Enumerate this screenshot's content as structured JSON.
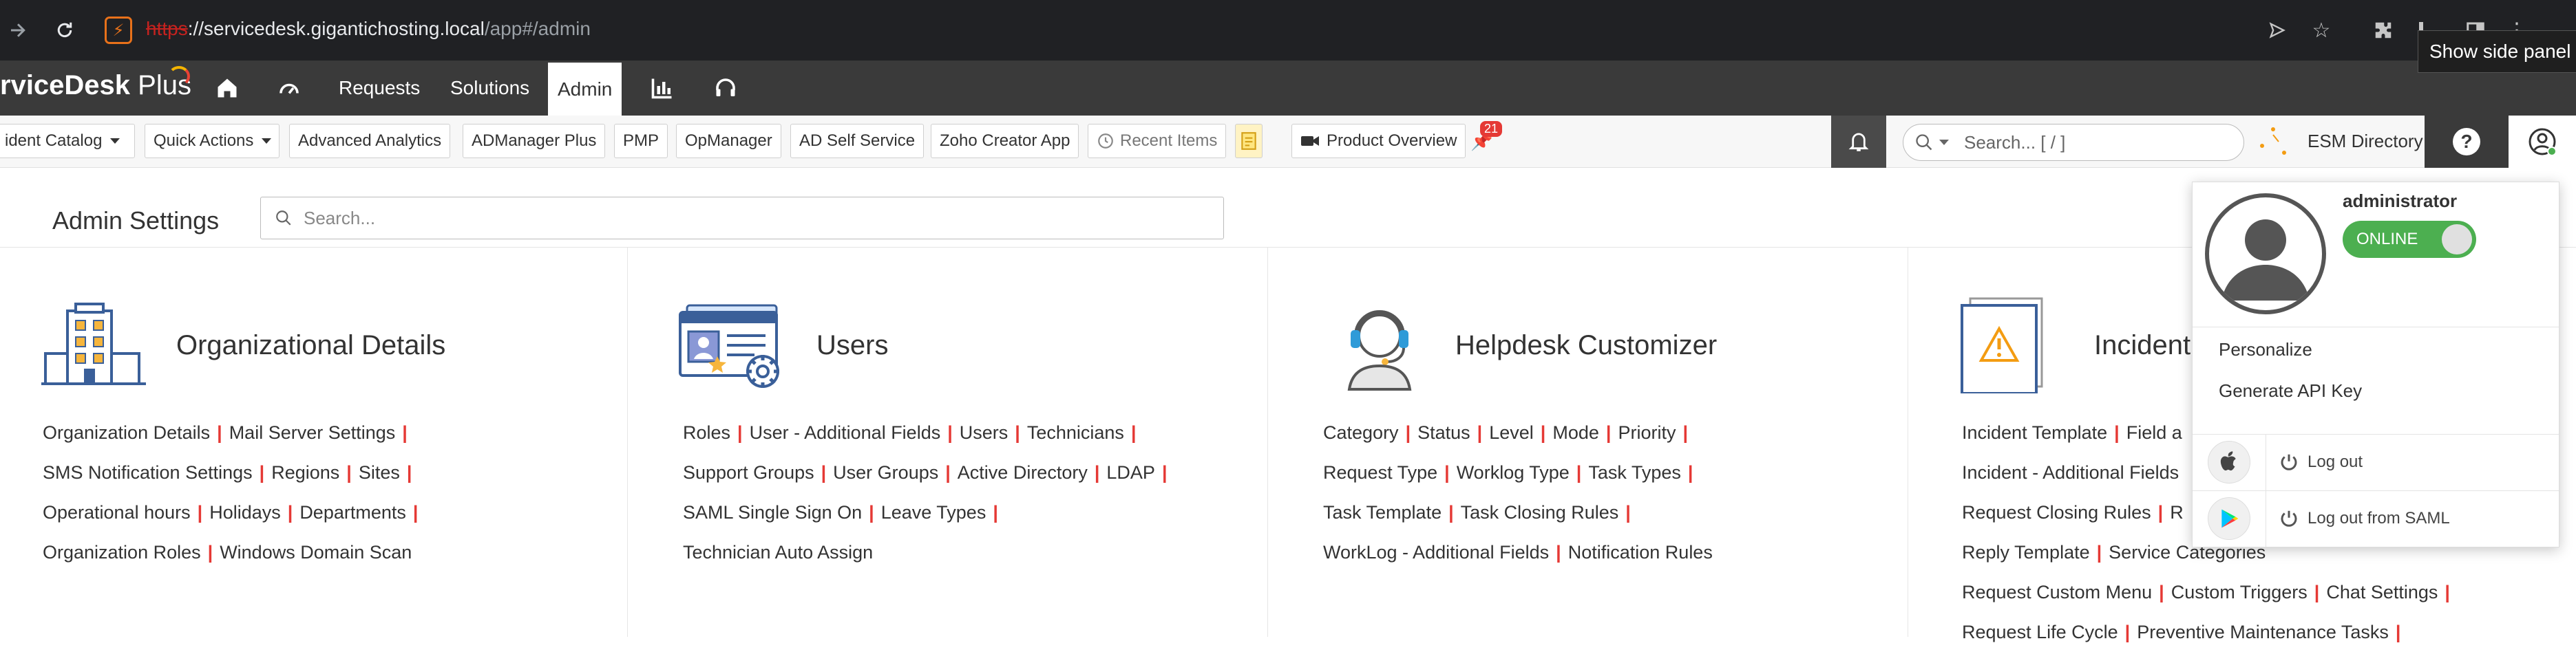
{
  "browser": {
    "url_protocol": "https",
    "url_host": "://servicedesk.gigantichosting.local",
    "url_path": "/app#/admin",
    "tooltip": "Show side panel"
  },
  "app": {
    "logo_bold": "rviceDesk",
    "logo_light": " Plus",
    "nav_tabs": [
      "Requests",
      "Solutions",
      "Admin"
    ],
    "active_tab": "Admin"
  },
  "toolbar": {
    "items": [
      "ident Catalog",
      "Quick Actions",
      "Advanced Analytics",
      "ADManager Plus",
      "PMP",
      "OpManager",
      "AD Self Service",
      "Zoho Creator App",
      "Recent Items",
      "Product Overview"
    ],
    "notification_count": "21",
    "search_placeholder": "Search... [ / ]",
    "esm_label": "ESM Directory"
  },
  "admin": {
    "title": "Admin Settings",
    "search_placeholder": "Search..."
  },
  "cards": [
    {
      "title": "Organizational Details",
      "rows": [
        [
          "Organization Details",
          "Mail Server Settings"
        ],
        [
          "SMS Notification Settings",
          "Regions",
          "Sites"
        ],
        [
          "Operational hours",
          "Holidays",
          "Departments"
        ],
        [
          "Organization Roles",
          "Windows Domain Scan"
        ]
      ]
    },
    {
      "title": "Users",
      "rows": [
        [
          "Roles",
          "User - Additional Fields",
          "Users",
          "Technicians"
        ],
        [
          "Support Groups",
          "User Groups",
          "Active Directory",
          "LDAP"
        ],
        [
          "SAML Single Sign On",
          "Leave Types"
        ],
        [
          "Technician Auto Assign"
        ]
      ]
    },
    {
      "title": "Helpdesk Customizer",
      "rows": [
        [
          "Category",
          "Status",
          "Level",
          "Mode",
          "Priority"
        ],
        [
          "Request Type",
          "Worklog Type",
          "Task Types"
        ],
        [
          "Task Template",
          "Task Closing Rules"
        ],
        [
          "WorkLog - Additional Fields",
          "Notification Rules"
        ]
      ]
    },
    {
      "title": "Incident",
      "rows": [
        [
          "Incident Template",
          "Field a"
        ],
        [
          "Incident - Additional Fields"
        ],
        [
          "Request Closing Rules",
          "R"
        ],
        [
          "Reply Template",
          "Service Categories"
        ],
        [
          "Request Custom Menu",
          "Custom Triggers",
          "Chat Settings"
        ],
        [
          "Request Life Cycle",
          "Preventive Maintenance Tasks"
        ]
      ]
    }
  ],
  "profile_menu": {
    "username": "administrator",
    "status": "ONLINE",
    "personalize": "Personalize",
    "api_key": "Generate API Key",
    "logout": "Log out",
    "logout_saml": "Log out from SAML"
  }
}
